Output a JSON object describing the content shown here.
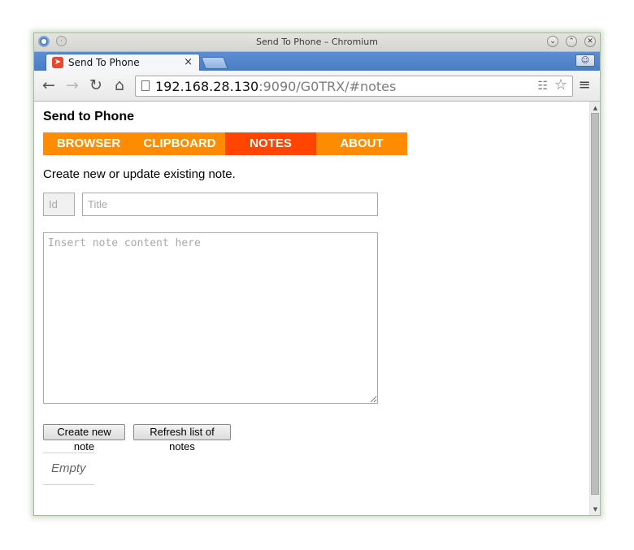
{
  "window": {
    "title": "Send To Phone – Chromium"
  },
  "browser": {
    "tab_title": "Send To Phone",
    "tab_close": "×",
    "url_host": "192.168.28.130",
    "url_rest": ":9090/G0TRX/#notes"
  },
  "icons": {
    "back": "←",
    "forward": "→",
    "reload": "↻",
    "home": "⌂",
    "star": "☆",
    "translate": "☷",
    "menu": "≡",
    "minimize": "⌄",
    "maximize": "⌃",
    "close": "✕",
    "profile": "☺"
  },
  "page": {
    "title": "Send to Phone",
    "tabs": [
      {
        "label": "BROWSER",
        "active": false
      },
      {
        "label": "CLIPBOARD",
        "active": false
      },
      {
        "label": "NOTES",
        "active": true
      },
      {
        "label": "ABOUT",
        "active": false
      }
    ],
    "intro": "Create new or update existing note.",
    "id_placeholder": "Id",
    "title_placeholder": "Title",
    "content_placeholder": "Insert note content here",
    "create_button": "Create new note",
    "refresh_button": "Refresh list of notes",
    "notes_empty": "Empty"
  },
  "colors": {
    "tab_bg": "#ff8c00",
    "tab_active_bg": "#ff4500"
  }
}
